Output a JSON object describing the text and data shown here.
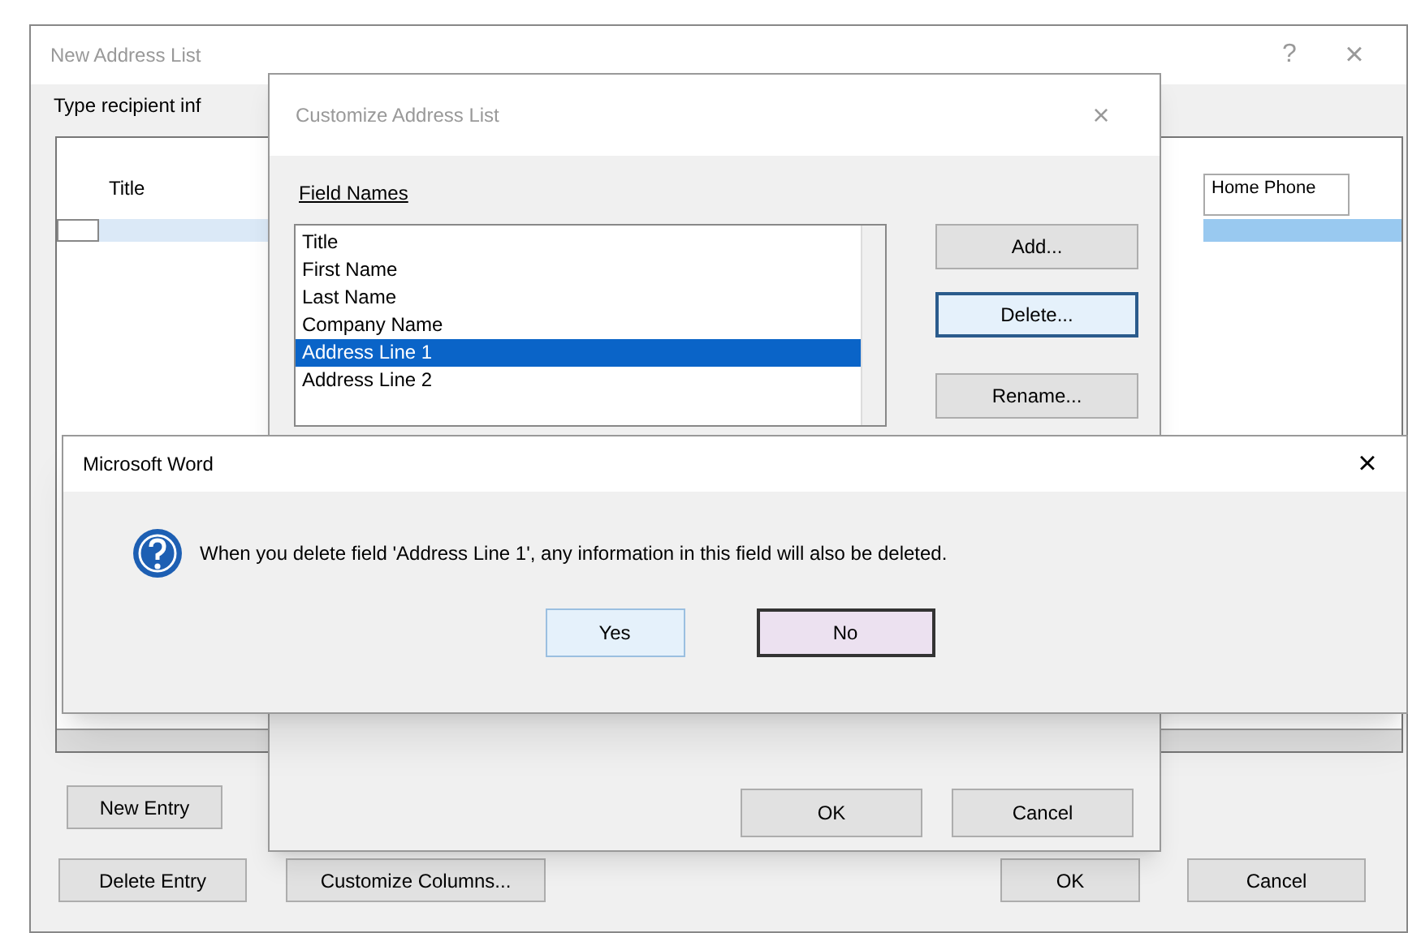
{
  "address_list_window": {
    "title": "New Address List",
    "help": "?",
    "close": "×",
    "label": "Type recipient inf",
    "columns": [
      {
        "label": "Title"
      },
      {
        "label": "Home Phone"
      }
    ],
    "buttons": [
      "New Entry",
      "Delete Entry",
      "Customize Columns...",
      "OK",
      "Cancel"
    ]
  },
  "customize_dialog": {
    "title": "Customize Address List",
    "close": "×",
    "field_names_label": "Field Names",
    "fields": [
      {
        "label": "Title",
        "selected": false
      },
      {
        "label": "First Name",
        "selected": false
      },
      {
        "label": "Last Name",
        "selected": false
      },
      {
        "label": "Company Name",
        "selected": false
      },
      {
        "label": "Address Line 1",
        "selected": true
      },
      {
        "label": "Address Line 2",
        "selected": false
      }
    ],
    "side_buttons": [
      {
        "label": "Add...",
        "focused": false
      },
      {
        "label": "Delete...",
        "focused": true
      },
      {
        "label": "Rename...",
        "focused": false
      }
    ],
    "buttons": [
      "OK",
      "Cancel"
    ]
  },
  "message_box": {
    "title": "Microsoft Word",
    "close": "×",
    "message": "When you delete field 'Address Line 1', any information in this field will also be deleted.",
    "buttons": [
      {
        "label": "Yes",
        "default": false
      },
      {
        "label": "No",
        "default": true
      }
    ]
  }
}
